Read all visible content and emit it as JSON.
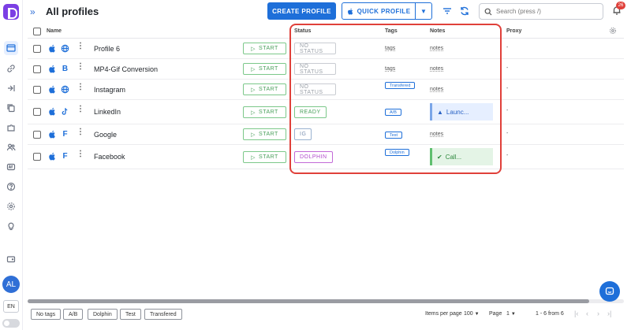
{
  "header": {
    "title": "All profiles",
    "create_label": "CREATE PROFILE",
    "quick_label": "QUICK PROFILE",
    "search_placeholder": "Search (press /)",
    "notifications_count": "26"
  },
  "table": {
    "columns": {
      "name": "Name",
      "status": "Status",
      "tags": "Tags",
      "notes": "Notes",
      "proxy": "Proxy"
    },
    "start_label": "START",
    "rows": [
      {
        "name": "Profile 6",
        "os2": "globe",
        "status": "NO STATUS",
        "status_kind": "none",
        "tags": "tags",
        "tag_is_chip": false,
        "notes": "notes",
        "note_kind": "text",
        "proxy": "-"
      },
      {
        "name": "MP4-Gif Conversion",
        "os2": "B",
        "status": "NO STATUS",
        "status_kind": "none",
        "tags": "tags",
        "tag_is_chip": false,
        "notes": "notes",
        "note_kind": "text",
        "proxy": "-"
      },
      {
        "name": "Instagram",
        "os2": "globe",
        "status": "NO STATUS",
        "status_kind": "none",
        "tags": "Transfered",
        "tag_is_chip": true,
        "notes": "notes",
        "note_kind": "text",
        "proxy": "-"
      },
      {
        "name": "LinkedIn",
        "os2": "tiktok",
        "status": "READY",
        "status_kind": "ready",
        "tags": "A/B",
        "tag_is_chip": true,
        "notes": "Launc...",
        "note_kind": "warning",
        "proxy": "-"
      },
      {
        "name": "Google",
        "os2": "F",
        "status": "IG",
        "status_kind": "ig",
        "tags": "Test",
        "tag_is_chip": true,
        "notes": "notes",
        "note_kind": "text",
        "proxy": "-"
      },
      {
        "name": "Facebook",
        "os2": "F",
        "status": "DOLPHIN",
        "status_kind": "dolphin",
        "tags": "Dolphin",
        "tag_is_chip": true,
        "notes": "Call...",
        "note_kind": "success",
        "proxy": "-"
      }
    ]
  },
  "sidebar": {
    "avatar": "AL",
    "language": "EN"
  },
  "footer": {
    "tag_filters": [
      "No tags",
      "A/B",
      "Dolphin",
      "Test",
      "Transfered"
    ],
    "items_per_page_label": "Items per page",
    "items_per_page_value": "100",
    "page_label": "Page",
    "page_value": "1",
    "range": "1 - 6 from 6"
  },
  "colors": {
    "accent": "#1e6fd9",
    "highlight": "#e0403a",
    "logo": "#7b3fe4"
  }
}
